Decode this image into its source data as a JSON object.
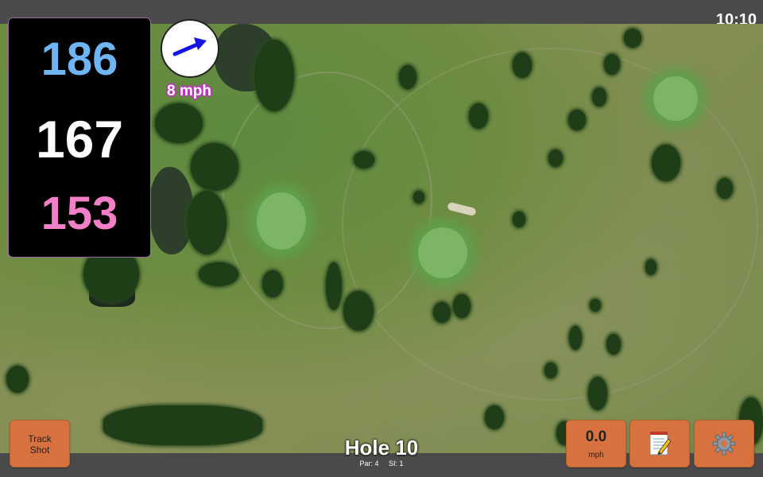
{
  "status": {
    "time": "10:10"
  },
  "distances": {
    "back": "186",
    "middle": "167",
    "front": "153"
  },
  "wind": {
    "speed": "8 mph",
    "direction_icon": "arrow-right-up-icon"
  },
  "hole": {
    "title": "Hole 10",
    "par": "Par: 4",
    "si": "SI: 1"
  },
  "buttons": {
    "track_shot": "Track\nShot",
    "speed_value": "0.0",
    "speed_unit": "mph",
    "notes_icon": "notepad-icon",
    "settings_icon": "gear-icon"
  },
  "colors": {
    "back_distance": "#6fb4f3",
    "middle_distance": "#ffffff",
    "front_distance": "#f37fc8",
    "button_bg": "#d7723f",
    "wind_arrow": "#1414e6"
  }
}
